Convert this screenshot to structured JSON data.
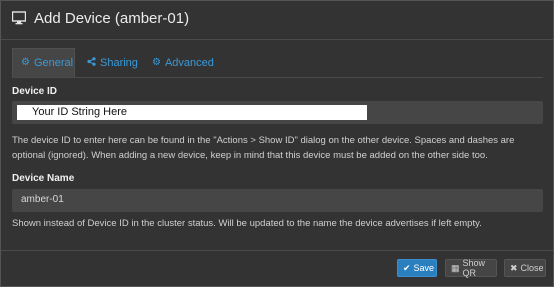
{
  "dialog": {
    "title": "Add Device (amber-01)"
  },
  "tabs": [
    {
      "label": "General",
      "icon": "gear-icon"
    },
    {
      "label": "Sharing",
      "icon": "share-icon"
    },
    {
      "label": "Advanced",
      "icon": "cogs-icon"
    }
  ],
  "device_id": {
    "label": "Device ID",
    "value": "Your ID String Here",
    "help": "The device ID to enter here can be found in the \"Actions > Show ID\" dialog on the other device. Spaces and dashes are optional (ignored). When adding a new device, keep in mind that this device must be added on the other side too."
  },
  "device_name": {
    "label": "Device Name",
    "value": "amber-01",
    "help": "Shown instead of Device ID in the cluster status. Will be updated to the name the device advertises if left empty."
  },
  "footer": {
    "save_label": "Save",
    "show_qr_label": "Show QR",
    "close_label": "Close"
  },
  "colors": {
    "accent": "#3a9ad9",
    "primary_button": "#2a7fbf",
    "background": "#333333"
  }
}
